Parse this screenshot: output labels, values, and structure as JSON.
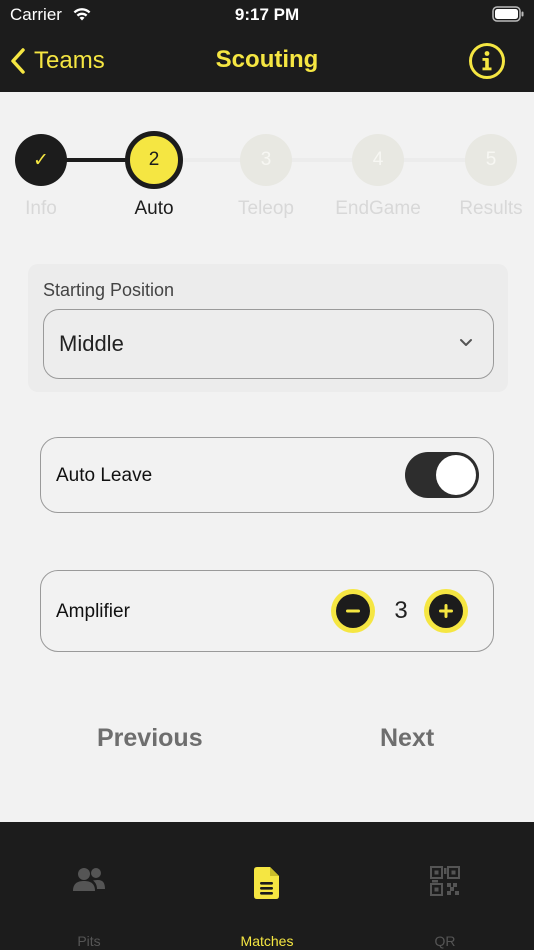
{
  "status_bar": {
    "carrier": "Carrier",
    "time": "9:17 PM"
  },
  "nav": {
    "back_label": "Teams",
    "title": "Scouting"
  },
  "steps": [
    {
      "label": "Info",
      "marker": "✓",
      "state": "done"
    },
    {
      "label": "Auto",
      "marker": "2",
      "state": "active"
    },
    {
      "label": "Teleop",
      "marker": "3",
      "state": "pending"
    },
    {
      "label": "EndGame",
      "marker": "4",
      "state": "pending"
    },
    {
      "label": "Results",
      "marker": "5",
      "state": "pending"
    }
  ],
  "starting_position": {
    "label": "Starting Position",
    "value": "Middle"
  },
  "auto_leave": {
    "label": "Auto Leave",
    "on": true
  },
  "amplifier": {
    "label": "Amplifier",
    "value": "3"
  },
  "footer_nav": {
    "previous": "Previous",
    "next": "Next"
  },
  "tabs": [
    {
      "label": "Pits",
      "icon": "people-icon",
      "selected": false
    },
    {
      "label": "Matches",
      "icon": "document-icon",
      "selected": true
    },
    {
      "label": "QR",
      "icon": "qr-code-icon",
      "selected": false
    }
  ],
  "colors": {
    "accent": "#f5e642",
    "dark": "#1c1c1c",
    "background": "#f2f2f2"
  }
}
